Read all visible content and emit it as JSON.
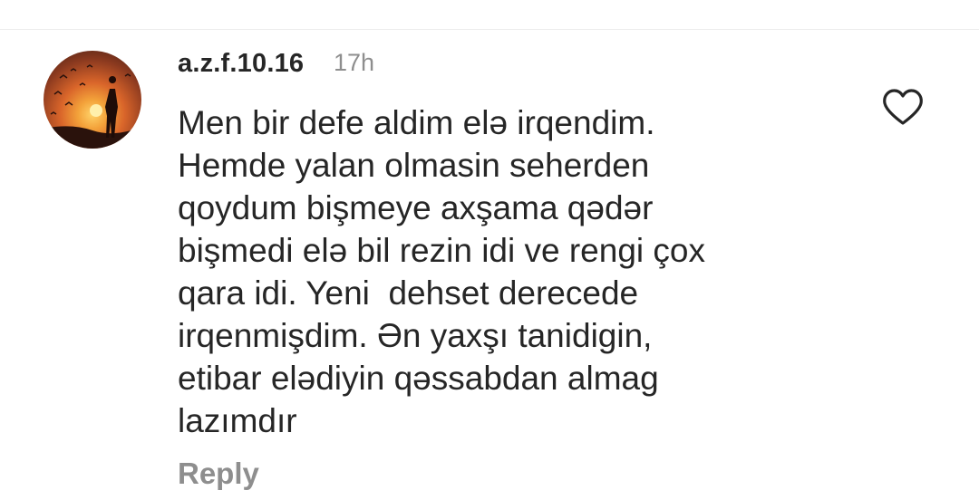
{
  "comment": {
    "username": "a.z.f.10.16",
    "timestamp": "17h",
    "text": "Men bir defe aldim elə irqendim.\nHemde yalan olmasin seherden\nqoydum bişmeye axşama qədər\nbişmedi elə bil rezin idi ve rengi çox\nqara idi. Yeni  dehset derecede\nirqenmişdim. Ən yaxşı tanidigin,\netibar elədiyin qəssabdan almag\nlazımdır",
    "reply_label": "Reply",
    "like_icon": "heart-outline-icon",
    "avatar_icon": "sunset-silhouette-avatar"
  },
  "colors": {
    "text_primary": "#262626",
    "text_secondary": "#8e8e8e",
    "divider": "#ededed"
  }
}
